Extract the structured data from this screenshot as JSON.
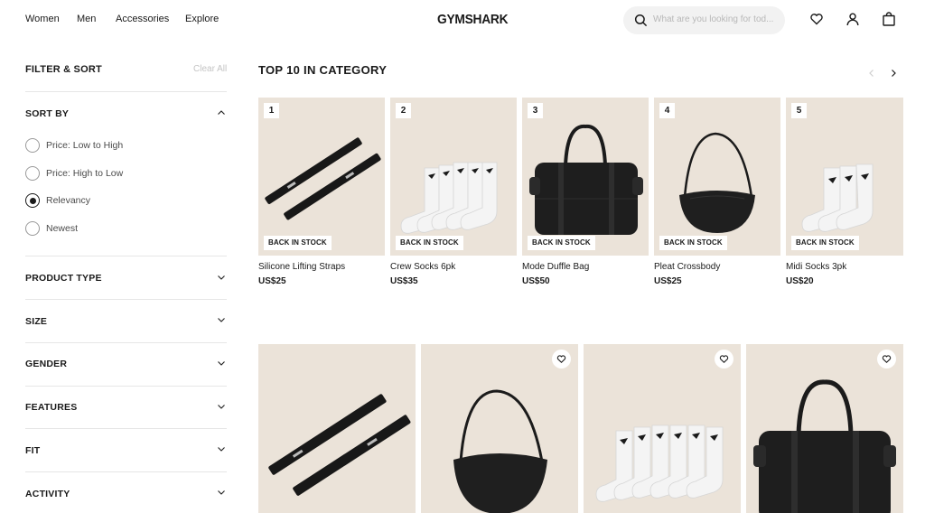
{
  "header": {
    "nav": [
      {
        "label": "Women"
      },
      {
        "label": "Men"
      },
      {
        "label": "Accessories"
      },
      {
        "label": "Explore"
      }
    ],
    "logo": "GYMSHARK",
    "search_placeholder": "What are you looking for tod..."
  },
  "sidebar": {
    "title": "FILTER & SORT",
    "clear_all": "Clear All",
    "sort_by": {
      "title": "SORT BY",
      "options": [
        {
          "label": "Price: Low to High",
          "selected": false
        },
        {
          "label": "Price: High to Low",
          "selected": false
        },
        {
          "label": "Relevancy",
          "selected": true
        },
        {
          "label": "Newest",
          "selected": false
        }
      ]
    },
    "sections": [
      {
        "title": "PRODUCT TYPE"
      },
      {
        "title": "SIZE"
      },
      {
        "title": "GENDER"
      },
      {
        "title": "FEATURES"
      },
      {
        "title": "FIT"
      },
      {
        "title": "ACTIVITY"
      }
    ]
  },
  "top10": {
    "title": "TOP 10 IN CATEGORY",
    "products": [
      {
        "rank": "1",
        "badge": "BACK IN STOCK",
        "name": "Silicone Lifting Straps",
        "price": "US$25"
      },
      {
        "rank": "2",
        "badge": "BACK IN STOCK",
        "name": "Crew Socks 6pk",
        "price": "US$35"
      },
      {
        "rank": "3",
        "badge": "BACK IN STOCK",
        "name": "Mode Duffle Bag",
        "price": "US$50"
      },
      {
        "rank": "4",
        "badge": "BACK IN STOCK",
        "name": "Pleat Crossbody",
        "price": "US$25"
      },
      {
        "rank": "5",
        "badge": "BACK IN STOCK",
        "name": "Midi Socks 3pk",
        "price": "US$20"
      }
    ]
  },
  "colors": {
    "card_bg": "#ebe3d9",
    "text": "#1a1a1a",
    "muted": "#c4c4c4"
  },
  "grid": {
    "items": [
      {
        "image": "lifting-straps"
      },
      {
        "image": "crossbody-bag"
      },
      {
        "image": "crew-socks"
      },
      {
        "image": "duffle-bag"
      }
    ]
  }
}
